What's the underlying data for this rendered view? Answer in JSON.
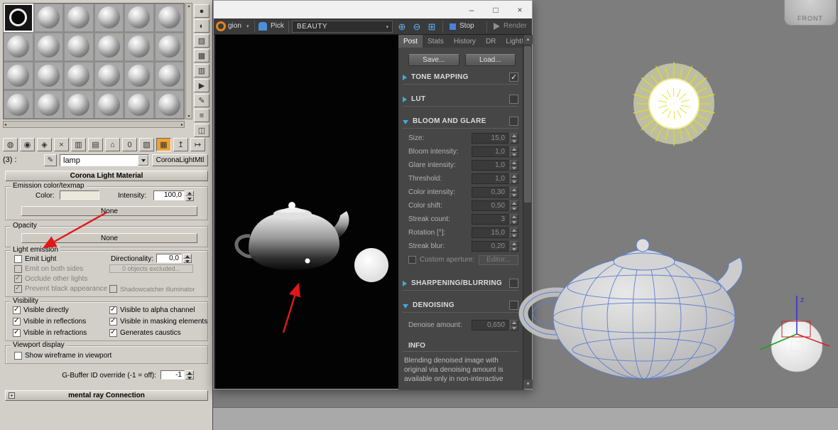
{
  "colors": {
    "accent_orange": "#f0a030",
    "arrow_red": "#e01818",
    "wireframe_blue": "#5e7fd4",
    "sun_yellow": "#dede1c",
    "viewport_gray": "#7d7d7d"
  },
  "viewport": {
    "viewcube_label": "FRONT",
    "axis_z_label": "z"
  },
  "window_controls": {
    "minimize": "–",
    "maximize": "□",
    "close": "×"
  },
  "material_editor": {
    "slots": [
      {
        "active": true
      },
      {
        "active": false
      },
      {
        "active": false
      },
      {
        "active": false
      },
      {
        "active": false
      },
      {
        "active": false
      },
      {
        "active": false
      },
      {
        "active": false
      },
      {
        "active": false
      },
      {
        "active": false
      },
      {
        "active": false
      },
      {
        "active": false
      },
      {
        "active": false
      },
      {
        "active": false
      },
      {
        "active": false
      },
      {
        "active": false
      },
      {
        "active": false
      },
      {
        "active": false
      },
      {
        "active": false
      },
      {
        "active": false
      },
      {
        "active": false
      },
      {
        "active": false
      },
      {
        "active": false
      },
      {
        "active": false
      }
    ],
    "scroll": {
      "up": "▴",
      "down": "▾",
      "left": "◂",
      "right": "▸"
    },
    "side_icons": [
      {
        "name": "sample-type-icon",
        "glyph": "●"
      },
      {
        "name": "backlight-icon",
        "glyph": "◐"
      },
      {
        "name": "background-icon",
        "glyph": "▨"
      },
      {
        "name": "sample-uv-tiling-icon",
        "glyph": "▦"
      },
      {
        "name": "video-color-check-icon",
        "glyph": "▥"
      },
      {
        "name": "make-preview-icon",
        "glyph": "▶"
      },
      {
        "name": "options-icon",
        "glyph": "✎"
      },
      {
        "name": "select-by-material-icon",
        "glyph": "≡"
      },
      {
        "name": "material-map-navigator-icon",
        "glyph": "◫"
      }
    ],
    "toolbar_icons": [
      {
        "name": "get-material-icon",
        "glyph": "◍",
        "active": false
      },
      {
        "name": "put-material-to-scene-icon",
        "glyph": "◉",
        "active": false
      },
      {
        "name": "assign-material-to-selection-icon",
        "glyph": "◈",
        "active": false
      },
      {
        "name": "reset-map-icon",
        "glyph": "×",
        "active": false
      },
      {
        "name": "make-material-copy-icon",
        "glyph": "▥",
        "active": false
      },
      {
        "name": "make-unique-icon",
        "glyph": "▤",
        "active": false
      },
      {
        "name": "put-to-library-icon",
        "glyph": "⌂",
        "active": false
      },
      {
        "name": "material-id-channel-icon",
        "glyph": "0",
        "active": false
      },
      {
        "name": "show-background-icon",
        "glyph": "▧",
        "active": false
      },
      {
        "name": "show-map-in-viewport-icon",
        "glyph": "▦",
        "active": true
      },
      {
        "name": "go-to-parent-icon",
        "glyph": "↥",
        "active": false
      },
      {
        "name": "go-forward-icon",
        "glyph": "↦",
        "active": false
      }
    ],
    "index_label": "(3) :",
    "picker_glyph": "✎",
    "combo_arrow": "▾",
    "name_value": "lamp",
    "type_button": "CoronaLightMtl",
    "rollout_title": "Corona Light Material",
    "emission": {
      "title": "Emission color/texmap",
      "color_label": "Color:",
      "intensity_label": "Intensity:",
      "intensity_value": "100,0",
      "texmap_button": "None"
    },
    "opacity": {
      "title": "Opacity",
      "texmap_button": "None"
    },
    "light_emission": {
      "title": "Light emission",
      "emit_light": {
        "label": "Emit Light",
        "checked": false
      },
      "directionality_label": "Directionality:",
      "directionality_value": "0,0",
      "emit_both_sides": {
        "label": "Emit on both sides",
        "checked": false
      },
      "exclude_button": "0 objects excluded...",
      "occlude": {
        "label": "Occlude other lights",
        "checked": true
      },
      "prevent_black": {
        "label": "Prevent black appearance",
        "checked": true
      },
      "shadowcatcher": {
        "label": "Shadowcatcher illuminator",
        "checked": false
      }
    },
    "visibility": {
      "title": "Visibility",
      "items": [
        {
          "label": "Visible directly",
          "checked": true
        },
        {
          "label": "Visible to alpha channel",
          "checked": true
        },
        {
          "label": "Visible in reflections",
          "checked": true
        },
        {
          "label": "Visible in masking elements",
          "checked": true
        },
        {
          "label": "Visible in refractions",
          "checked": true
        },
        {
          "label": "Generates caustics",
          "checked": true
        }
      ]
    },
    "viewport_display": {
      "title": "Viewport display",
      "show_wireframe": {
        "label": "Show wireframe in viewport",
        "checked": false
      }
    },
    "gbuffer": {
      "label": "G-Buffer ID override (-1 = off):",
      "value": "-1"
    },
    "mental_ray": {
      "title": "mental ray Connection",
      "expand_glyph": "+"
    }
  },
  "vfb": {
    "toolbar": {
      "region_label": "gion",
      "dropdown_glyph": "▾",
      "pick_label": "Pick",
      "channel_value": "BEAUTY",
      "zoom_icons": [
        {
          "name": "zoom-in-icon",
          "glyph": "⊕"
        },
        {
          "name": "zoom-out-icon",
          "glyph": "⊖"
        },
        {
          "name": "zoom-region-icon",
          "glyph": "⊞"
        }
      ],
      "stop_label": "Stop",
      "render_label": "Render"
    },
    "tabs": [
      {
        "label": "Post",
        "active": true
      },
      {
        "label": "Stats",
        "active": false
      },
      {
        "label": "History",
        "active": false
      },
      {
        "label": "DR",
        "active": false
      },
      {
        "label": "LightMix",
        "active": false
      }
    ],
    "post": {
      "save_button": "Save...",
      "load_button": "Load...",
      "tone_mapping": {
        "label": "TONE MAPPING",
        "checked": true
      },
      "lut": {
        "label": "LUT",
        "checked": false
      },
      "bloom": {
        "label": "BLOOM AND GLARE",
        "checked": false,
        "fields": [
          {
            "label": "Size:",
            "value": "15,0"
          },
          {
            "label": "Bloom intensity:",
            "value": "1,0"
          },
          {
            "label": "Glare intensity:",
            "value": "1,0"
          },
          {
            "label": "Threshold:",
            "value": "1,0"
          },
          {
            "label": "Color intensity:",
            "value": "0,30"
          },
          {
            "label": "Color shift:",
            "value": "0,50"
          },
          {
            "label": "Streak count:",
            "value": "3"
          },
          {
            "label": "Rotation [°]:",
            "value": "15,0"
          },
          {
            "label": "Streak blur:",
            "value": "0,20"
          }
        ],
        "custom_aperture": {
          "label": "Custom aperture:",
          "checked": false,
          "button": "Editor..."
        }
      },
      "sharpening": {
        "label": "SHARPENING/BLURRING",
        "checked": false
      },
      "denoising": {
        "label": "DENOISING",
        "checked": false,
        "amount_label": "Denoise amount:",
        "amount_value": "0,650"
      },
      "info": {
        "label": "INFO",
        "text": "Blending denoised image with original via denoising amount is available only in non-interactive"
      }
    }
  }
}
